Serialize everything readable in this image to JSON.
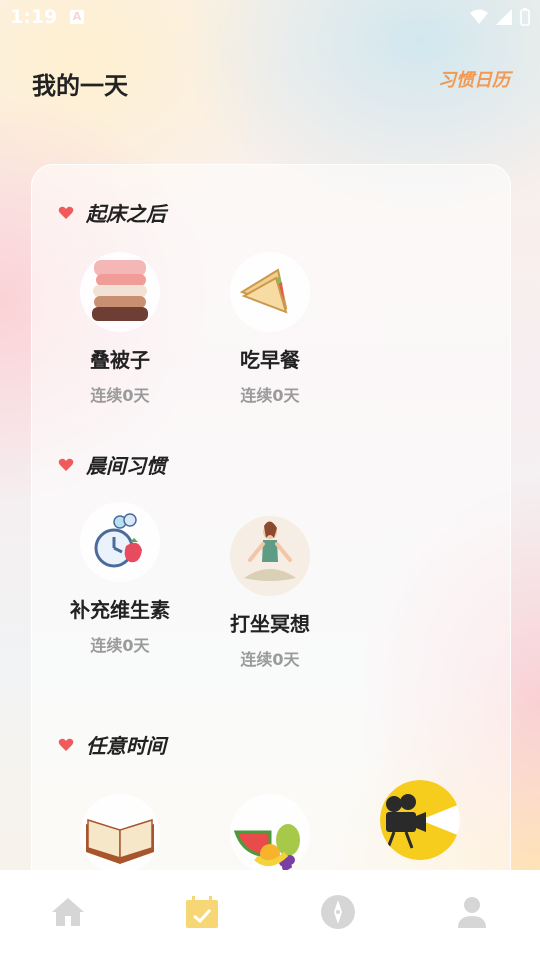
{
  "status_bar": {
    "time": "1:19"
  },
  "header": {
    "title": "我的一天",
    "calendar_link": "习惯日历"
  },
  "sections": [
    {
      "label": "起床之后",
      "habits": [
        {
          "name": "叠被子",
          "streak": "连续0天",
          "icon": "folded-blanket-icon"
        },
        {
          "name": "吃早餐",
          "streak": "连续0天",
          "icon": "sandwich-icon"
        }
      ]
    },
    {
      "label": "晨间习惯",
      "habits": [
        {
          "name": "补充维生素",
          "streak": "连续0天",
          "icon": "vitamin-icon"
        },
        {
          "name": "打坐冥想",
          "streak": "连续0天",
          "icon": "meditation-icon"
        }
      ]
    },
    {
      "label": "任意时间",
      "habits": [
        {
          "name": "",
          "streak": "",
          "icon": "book-icon"
        },
        {
          "name": "",
          "streak": "",
          "icon": "fruit-icon"
        },
        {
          "name": "",
          "streak": "",
          "icon": "movie-camera-icon"
        }
      ]
    }
  ],
  "tabbar": {
    "items": [
      "home-icon",
      "calendar-icon",
      "compass-icon",
      "profile-icon"
    ],
    "active_index": 1
  },
  "colors": {
    "accent": "#f29a54",
    "heart": "#f05a5a",
    "active_tab": "#f7d775",
    "inactive_tab": "#d6d6d6"
  }
}
